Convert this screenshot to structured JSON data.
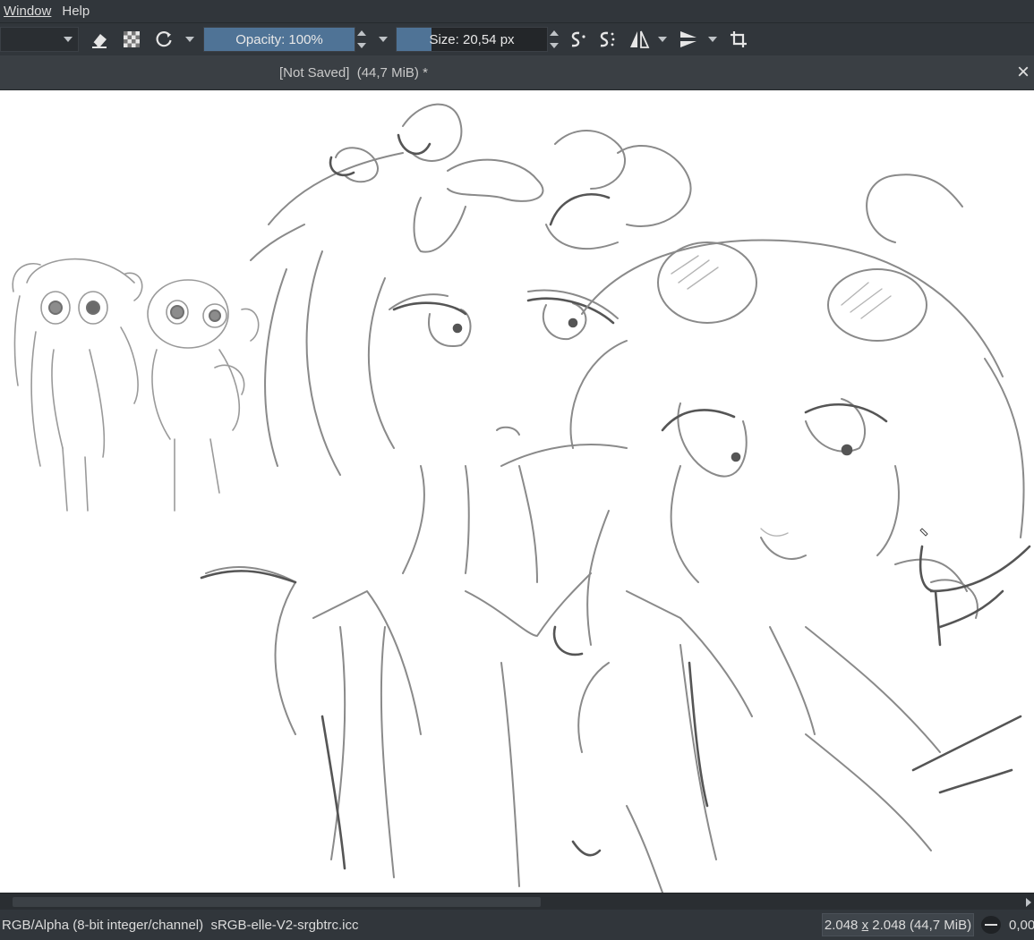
{
  "menu": {
    "items": [
      "Window",
      "Help"
    ]
  },
  "toolbar": {
    "opacity_label": "Opacity: 100%",
    "opacity_value": 1.0,
    "size_label": "Size: 20,54 px",
    "size_fill": 0.23,
    "icons": [
      "eraser-icon",
      "alpha-lock-icon",
      "reset-icon",
      "smoothing-icon",
      "stabilizer-icon",
      "mirror-horizontal-icon",
      "mirror-vertical-icon",
      "wrap-around-icon"
    ]
  },
  "document": {
    "title": "[Not Saved]  (44,7 MiB) *",
    "close": "×"
  },
  "status": {
    "color_profile": "RGB/Alpha (8-bit integer/channel)  sRGB-elle-V2-srgbtrc.icc",
    "size_w": "2.048",
    "size_x": "x",
    "size_h": "2.048 (44,7 MiB)",
    "rotation": "0,00"
  },
  "colors": {
    "chrome": "#31363b",
    "docbar": "#3a3f44",
    "slider_fill": "#4f7396",
    "sketch_stroke": "#7d7d7d"
  }
}
